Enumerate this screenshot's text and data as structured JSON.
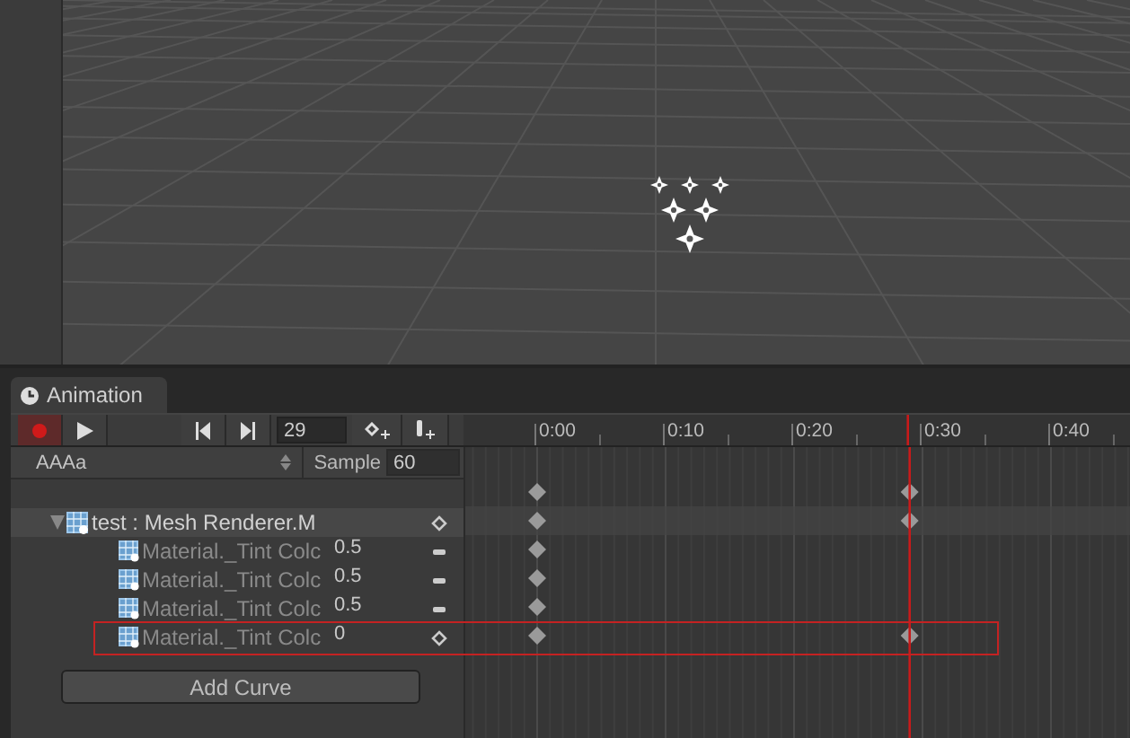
{
  "animation_window": {
    "tab": {
      "label": "Animation",
      "selected": true
    },
    "toolbar": {
      "recording": true,
      "frame": "29"
    },
    "clip": {
      "name": "AAAa",
      "sample_label": "Sample",
      "sample": "60"
    },
    "ruler": [
      "0:00",
      "0:10",
      "0:20",
      "0:30",
      "0:40"
    ],
    "summary_keys": {
      "start": true,
      "current": true
    },
    "tracks": [
      {
        "label": "test : Mesh Renderer.M",
        "expanded": true,
        "selected": true,
        "kind": "diamond",
        "keys": {
          "start": true,
          "current": true
        },
        "children": [
          {
            "label": "Material._Tint Colc",
            "value": "0.5",
            "kind": "dash",
            "disabled": true,
            "selected": false,
            "keys": {
              "start": true,
              "current": false
            }
          },
          {
            "label": "Material._Tint Colc",
            "value": "0.5",
            "kind": "dash",
            "disabled": true,
            "selected": false,
            "keys": {
              "start": true,
              "current": false
            }
          },
          {
            "label": "Material._Tint Colc",
            "value": "0.5",
            "kind": "dash",
            "disabled": true,
            "selected": false,
            "keys": {
              "start": true,
              "current": false
            }
          },
          {
            "label": "Material._Tint Colc",
            "value": "0",
            "kind": "diamond",
            "disabled": true,
            "selected": false,
            "outlined": true,
            "keys": {
              "start": true,
              "current": true
            }
          }
        ]
      }
    ],
    "add_curve": "Add Curve"
  }
}
